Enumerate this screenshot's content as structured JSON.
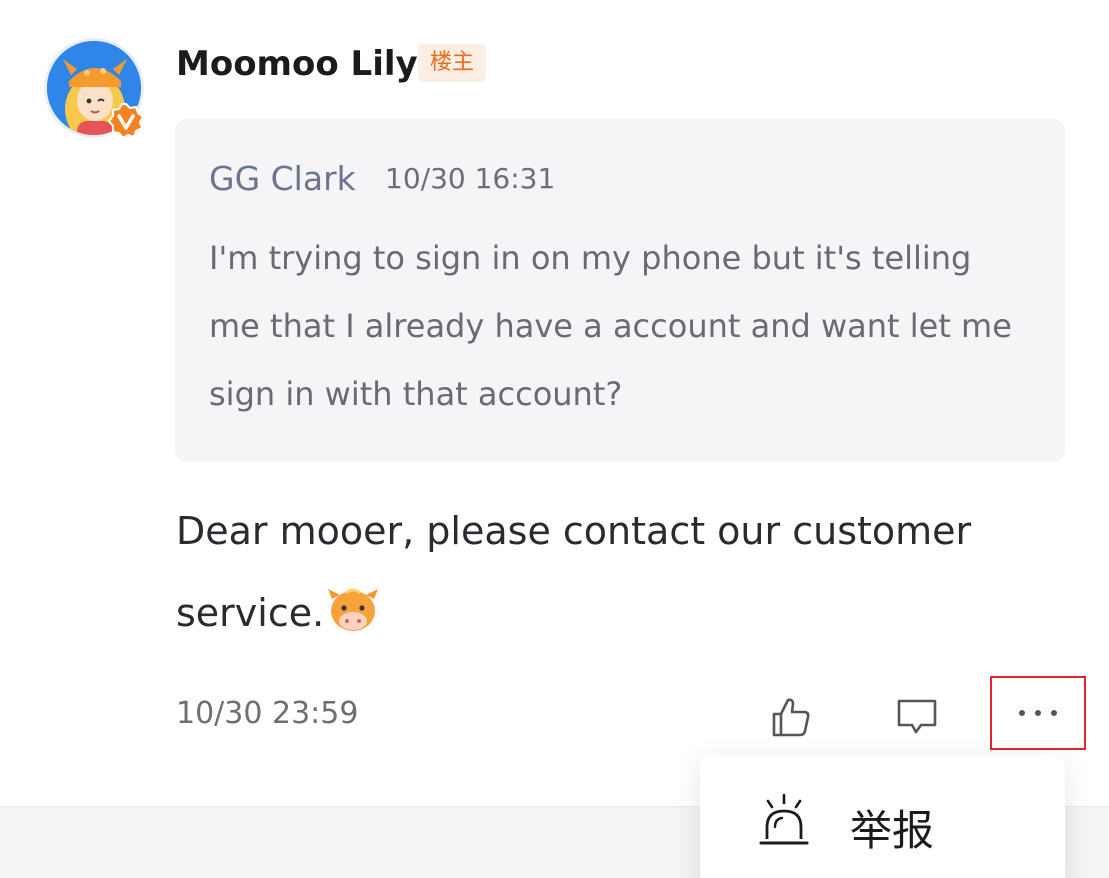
{
  "post": {
    "author": "Moomoo Lily",
    "author_badge": "楼主",
    "quote": {
      "author": "GG Clark",
      "time": "10/30 16:31",
      "text": "I'm trying to sign in on my phone but it's telling me that I already have a account and want let me sign in with that account?"
    },
    "reply_text": "Dear mooer, please contact our customer service.",
    "reply_time": "10/30 23:59"
  },
  "actions": {
    "like_icon": "thumbs-up-icon",
    "comment_icon": "comment-bubble-icon",
    "more_icon": "more-dots-icon"
  },
  "menu": {
    "items": [
      {
        "icon": "alarm-siren-icon",
        "label": "举报"
      }
    ]
  },
  "colors": {
    "accent_orange": "#f06a1a",
    "highlight_border": "#e3262b",
    "quote_bg": "#f5f5f7",
    "avatar_blue": "#2f86e8"
  }
}
